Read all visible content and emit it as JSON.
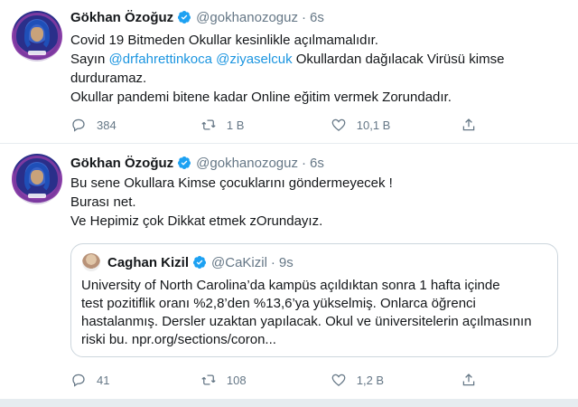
{
  "tweets": [
    {
      "author": {
        "name": "Gökhan Özoğuz",
        "handle": "@gokhanozoguz"
      },
      "time": "6s",
      "lines": [
        [
          {
            "t": "Covid 19 Bitmeden Okullar kesinlikle açılmamalıdır."
          }
        ],
        [
          {
            "t": "Sayın "
          },
          {
            "t": "@drfahrettinkoca",
            "mention": true
          },
          {
            "t": " "
          },
          {
            "t": "@ziyaselcuk",
            "mention": true
          },
          {
            "t": " Okullardan dağılacak Virüsü kimse"
          }
        ],
        [
          {
            "t": "durduramaz."
          }
        ],
        [
          {
            "t": "Okullar pandemi bitene kadar Online eğitim vermek Zorundadır."
          }
        ]
      ],
      "actions": {
        "reply": "384",
        "retweet": "1 B",
        "like": "10,1 B"
      }
    },
    {
      "author": {
        "name": "Gökhan Özoğuz",
        "handle": "@gokhanozoguz"
      },
      "time": "6s",
      "lines": [
        [
          {
            "t": "Bu sene Okullara Kimse çocuklarını göndermeyecek !"
          }
        ],
        [
          {
            "t": "Burası net."
          }
        ],
        [
          {
            "t": "Ve Hepimiz çok  Dikkat etmek zOrundayız."
          }
        ]
      ],
      "quote": {
        "author": {
          "name": "Caghan Kizil",
          "handle": "@CaKizil"
        },
        "time": "9s",
        "lines": [
          "University of North Carolina’da kampüs açıldıktan sonra 1 hafta içinde",
          "test pozitiflik oranı %2,8’den %13,6’ya yükselmiş. Onlarca öğrenci",
          "hastalanmış. Dersler uzaktan yapılacak. Okul ve üniversitelerin açılmasının",
          "riski bu. npr.org/sections/coron..."
        ]
      },
      "actions": {
        "reply": "41",
        "retweet": "108",
        "like": "1,2 B"
      }
    }
  ],
  "icons": {
    "reply": "reply-icon",
    "retweet": "retweet-icon",
    "like": "like-icon",
    "share": "share-icon",
    "verified": "verified-badge-icon"
  },
  "colors": {
    "link": "#1b95e0",
    "secondary": "#657786",
    "verified": "#1da1f2",
    "border": "#e6ecf0"
  }
}
